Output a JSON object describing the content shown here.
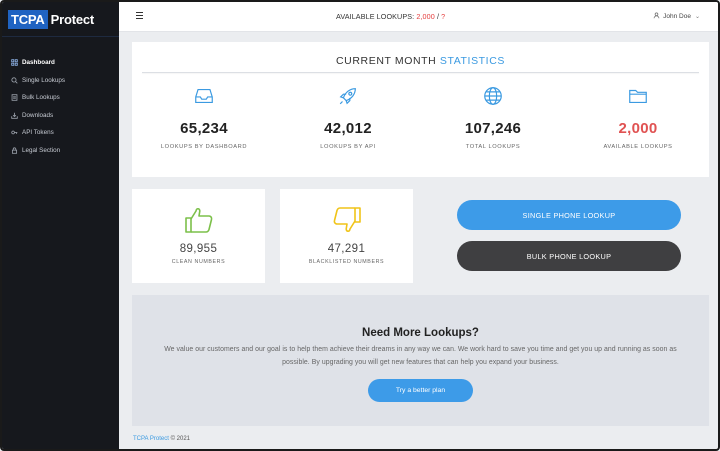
{
  "brand": {
    "logo_part1": "TCPA",
    "logo_part2": "Protect"
  },
  "sidebar": {
    "items": [
      {
        "label": "Dashboard"
      },
      {
        "label": "Single Lookups"
      },
      {
        "label": "Bulk Lookups"
      },
      {
        "label": "Downloads"
      },
      {
        "label": "API Tokens"
      },
      {
        "label": "Legal Section"
      }
    ]
  },
  "topbar": {
    "available_label": "AVAILABLE LOOKUPS:",
    "available_value": "2,000",
    "separator": " / ",
    "available_total": "?",
    "user_name": "John Doe"
  },
  "stats": {
    "title_part1": "CURRENT MONTH",
    "title_part2": "STATISTICS",
    "items": [
      {
        "value": "65,234",
        "label": "LOOKUPS BY DASHBOARD",
        "icon": "inbox-icon"
      },
      {
        "value": "42,012",
        "label": "LOOKUPS BY API",
        "icon": "rocket-icon"
      },
      {
        "value": "107,246",
        "label": "TOTAL LOOKUPS",
        "icon": "globe-icon"
      },
      {
        "value": "2,000",
        "label": "AVAILABLE LOOKUPS",
        "icon": "folder-icon"
      }
    ]
  },
  "clean": {
    "value": "89,955",
    "label": "CLEAN NUMBERS"
  },
  "blacklisted": {
    "value": "47,291",
    "label": "BLACKLISTED NUMBERS"
  },
  "actions": {
    "single_label": "SINGLE PHONE LOOKUP",
    "bulk_label": "BULK PHONE LOOKUP"
  },
  "upgrade": {
    "title": "Need More Lookups?",
    "text": "We value our customers and our goal is to help them achieve their dreams in any way we can. We work hard to save you time and get you up and running as soon as possible. By upgrading you will get new features that can help you expand your business.",
    "button_label": "Try a better plan"
  },
  "footer": {
    "brand_link": "TCPA Protect",
    "copyright": "© 2021"
  },
  "colors": {
    "accent": "#3b9ae1",
    "alert": "#e05252",
    "thumbs_up": "#7cc04a",
    "thumbs_down": "#f0c419",
    "sidebar": "#16181d"
  }
}
